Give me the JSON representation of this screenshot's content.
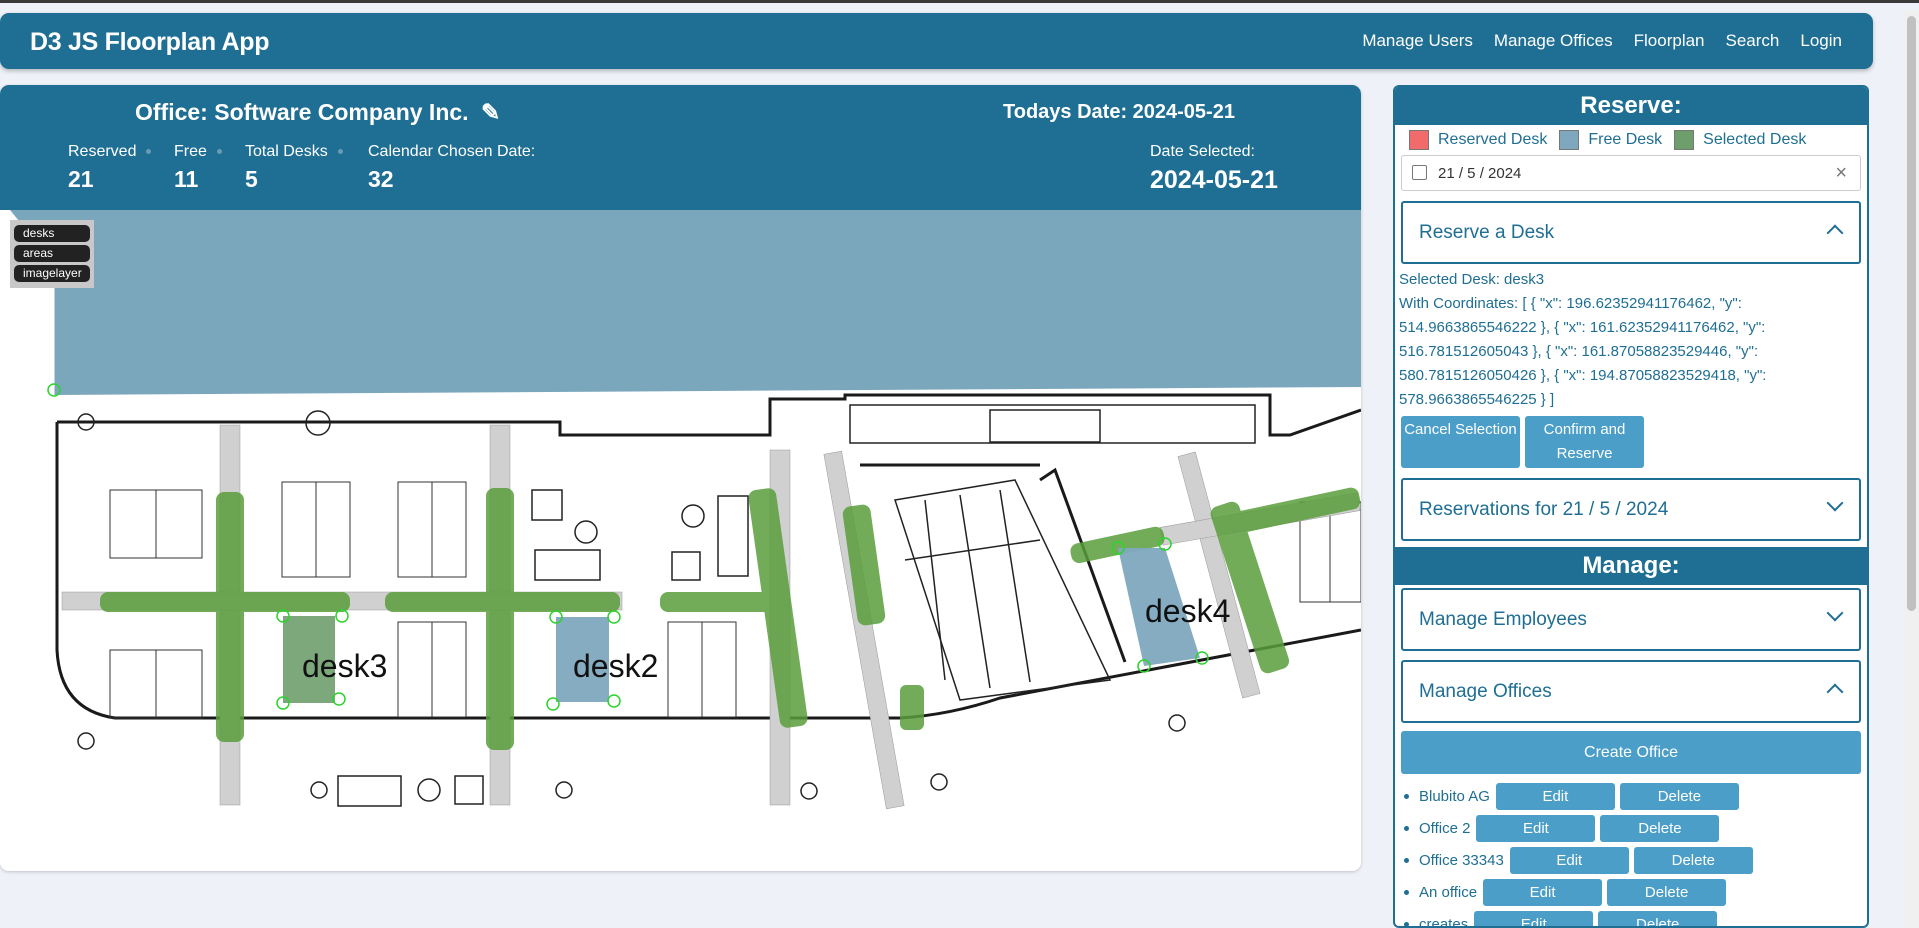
{
  "app": {
    "brand": "D3 JS Floorplan App",
    "nav": [
      "Manage Users",
      "Manage Offices",
      "Floorplan",
      "Search",
      "Login"
    ]
  },
  "header": {
    "office_title": "Office: Software Company Inc.",
    "today": "Todays Date: 2024-05-21",
    "stats": [
      {
        "label": "Reserved",
        "value": "21"
      },
      {
        "label": "Free",
        "value": "11"
      },
      {
        "label": "Total Desks",
        "value": "5"
      },
      {
        "label": "Calendar Chosen Date:",
        "value": "32"
      }
    ],
    "date_selected_label": "Date Selected:",
    "date_selected_value": "2024-05-21"
  },
  "layers": [
    "desks",
    "areas",
    "imagelayer"
  ],
  "desks": [
    {
      "label": "desk3",
      "status": "selected"
    },
    {
      "label": "desk2",
      "status": "free"
    },
    {
      "label": "desk4",
      "status": "free"
    }
  ],
  "colors": {
    "brand": "#1f6e93",
    "reserved": "#f26b6b",
    "free": "#7fa8bf",
    "selected": "#6f9e6d",
    "button": "#4a9ec8"
  },
  "reserve": {
    "heading": "Reserve:",
    "legend": [
      "Reserved Desk",
      "Free Desk",
      "Selected Desk"
    ],
    "date_value": "21 / 5 / 2024",
    "clear_icon": "×",
    "reserve_desk_title": "Reserve a Desk",
    "selected_desk": "Selected Desk: desk3",
    "coordinates": "With Coordinates: [ { \"x\": 196.62352941176462, \"y\": 514.9663865546222 }, { \"x\": 161.62352941176462, \"y\": 516.781512605043 }, { \"x\": 161.87058823529446, \"y\": 580.7815126050426 }, { \"x\": 194.87058823529418, \"y\": 578.9663865546225 } ]",
    "cancel_label": "Cancel Selection",
    "confirm_label": "Confirm and Reserve",
    "reservations_title": "Reservations for 21 / 5 / 2024"
  },
  "manage": {
    "heading": "Manage:",
    "employees_title": "Manage Employees",
    "offices_title": "Manage Offices",
    "create_label": "Create Office",
    "edit_label": "Edit",
    "delete_label": "Delete",
    "offices": [
      "Blubito AG",
      "Office 2",
      "Office 33343",
      "An office",
      "creates"
    ]
  }
}
